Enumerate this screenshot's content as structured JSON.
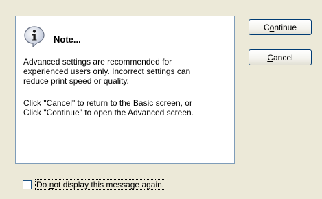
{
  "note": {
    "icon": "info-icon",
    "title": "Note...",
    "paragraph1": "Advanced settings are recommended for\nexperienced users only. Incorrect settings can\nreduce print speed or quality.",
    "paragraph2": "Click \"Cancel\" to return to the Basic screen, or\nClick \"Continue\" to open the Advanced screen."
  },
  "buttons": {
    "continue_pre": "C",
    "continue_key": "o",
    "continue_post": "ntinue",
    "cancel_pre": "",
    "cancel_key": "C",
    "cancel_post": "ancel"
  },
  "checkbox": {
    "checked": false,
    "label_pre": "Do ",
    "label_key": "n",
    "label_post": "ot display this message again."
  },
  "colors": {
    "dialog_bg": "#ECE9D8",
    "panel_bg": "#FFFFFF",
    "panel_border": "#7F9DB9",
    "button_border": "#003C74",
    "icon_fill": "#C8CFDF"
  }
}
